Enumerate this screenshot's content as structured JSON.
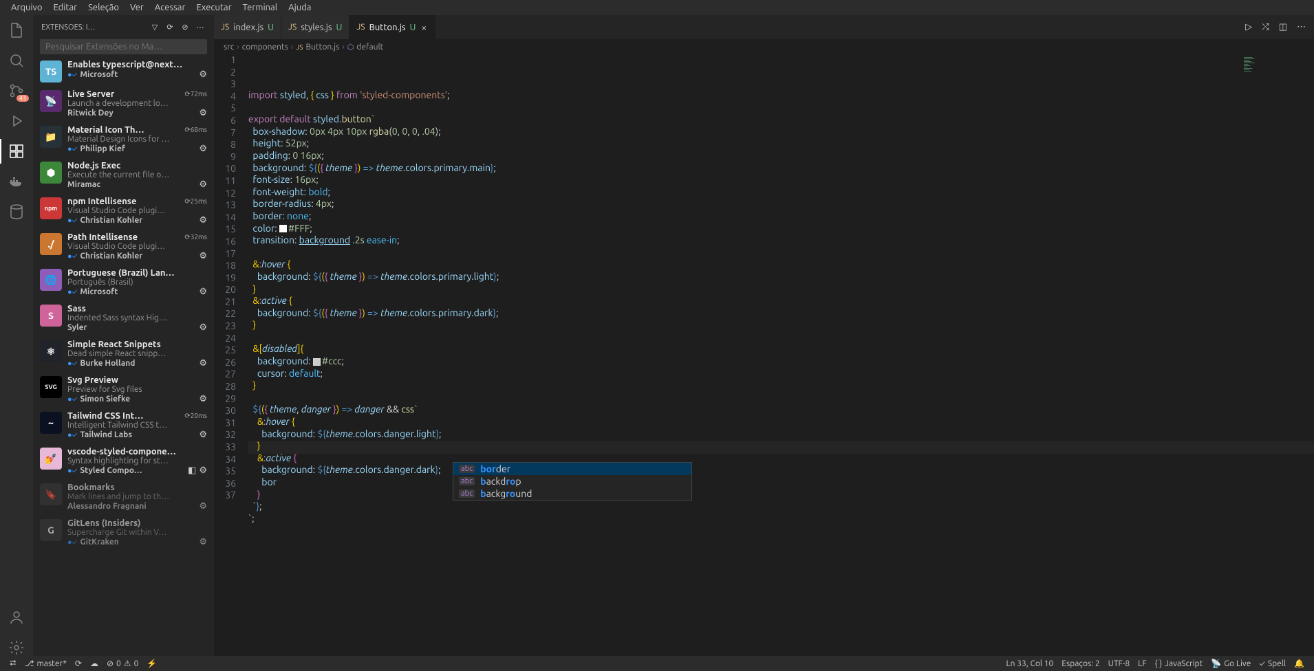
{
  "menubar": [
    "Arquivo",
    "Editar",
    "Seleção",
    "Ver",
    "Acessar",
    "Executar",
    "Terminal",
    "Ajuda"
  ],
  "sidebar": {
    "title": "EXTENSÕES: I…",
    "search_placeholder": "Pesquisar Extensões no Ma…",
    "items": [
      {
        "name": "Enables typescript@next…",
        "desc": "",
        "pub": "Microsoft",
        "verified": true,
        "time": "",
        "iconBg": "#5fb3d4",
        "iconTxt": "TS"
      },
      {
        "name": "Live Server",
        "desc": "Launch a development lo…",
        "pub": "Ritwick Dey",
        "verified": false,
        "time": "72ms",
        "iconBg": "#5a2a6e",
        "iconTxt": "📡"
      },
      {
        "name": "Material Icon Th…",
        "desc": "Material Design Icons for …",
        "pub": "Philipp Kief",
        "verified": true,
        "time": "68ms",
        "iconBg": "#263238",
        "iconTxt": "📁"
      },
      {
        "name": "Node.js Exec",
        "desc": "Execute the current file o…",
        "pub": "Miramac",
        "verified": false,
        "time": "",
        "iconBg": "#3c873a",
        "iconTxt": "⬢"
      },
      {
        "name": "npm Intellisense",
        "desc": "Visual Studio Code plugi…",
        "pub": "Christian Kohler",
        "verified": true,
        "time": "25ms",
        "iconBg": "#cb3837",
        "iconTxt": "npm"
      },
      {
        "name": "Path Intellisense",
        "desc": "Visual Studio Code plugi…",
        "pub": "Christian Kohler",
        "verified": true,
        "time": "32ms",
        "iconBg": "#cb7731",
        "iconTxt": "./"
      },
      {
        "name": "Portuguese (Brazil) Lan…",
        "desc": "Português (Brasil)",
        "pub": "Microsoft",
        "verified": true,
        "time": "",
        "iconBg": "#8f5db7",
        "iconTxt": "🌐"
      },
      {
        "name": "Sass",
        "desc": "Indented Sass syntax Hig…",
        "pub": "Syler",
        "verified": false,
        "time": "",
        "iconBg": "#cf649a",
        "iconTxt": "S"
      },
      {
        "name": "Simple React Snippets",
        "desc": "Dead simple React snipp…",
        "pub": "Burke Holland",
        "verified": true,
        "time": "",
        "iconBg": "#20232a",
        "iconTxt": "⚛"
      },
      {
        "name": "Svg Preview",
        "desc": "Preview for Svg files",
        "pub": "Simon Siefke",
        "verified": true,
        "time": "",
        "iconBg": "#000",
        "iconTxt": "SVG"
      },
      {
        "name": "Tailwind CSS Int…",
        "desc": "Intelligent Tailwind CSS t…",
        "pub": "Tailwind Labs",
        "verified": true,
        "time": "20ms",
        "iconBg": "#0b1120",
        "iconTxt": "~"
      },
      {
        "name": "vscode-styled-compone…",
        "desc": "Syntax highlighting for st…",
        "pub": "Styled Compo…",
        "verified": true,
        "time": "",
        "iconBg": "#e7b8d8",
        "iconTxt": "💅",
        "extra": "◧"
      },
      {
        "name": "Bookmarks",
        "desc": "Mark lines and jump to th…",
        "pub": "Alessandro Fragnani",
        "verified": false,
        "time": "",
        "iconBg": "#3a3a3a",
        "iconTxt": "🔖",
        "dim": true
      },
      {
        "name": "GitLens (Insiders)",
        "desc": "Supercharge Git within V…",
        "pub": "GitKraken",
        "verified": true,
        "time": "",
        "iconBg": "#3a3a3a",
        "iconTxt": "G",
        "dim": true
      }
    ]
  },
  "tabs": [
    {
      "label": "index.js",
      "status": "U",
      "active": false
    },
    {
      "label": "styles.js",
      "status": "U",
      "active": false
    },
    {
      "label": "Button.js",
      "status": "U",
      "active": true
    }
  ],
  "breadcrumb": [
    "src",
    "components",
    "Button.js",
    "default"
  ],
  "code": {
    "lines": 37,
    "text": "import styled, { css } from 'styled-components';\n\nexport default styled.button`\n  box-shadow: 0px 4px 10px rgba(0, 0, 0, .04);\n  height: 52px;\n  padding: 0 16px;\n  background: ${({ theme }) => theme.colors.primary.main};\n  font-size: 16px;\n  font-weight: bold;\n  border-radius: 4px;\n  border: none;\n  color: #FFF;\n  transition: background .2s ease-in;\n\n  &:hover {\n    background: ${({ theme }) => theme.colors.primary.light};\n  }\n  &:active {\n    background: ${({ theme }) => theme.colors.primary.dark};\n  }\n\n  &[disabled]{\n    background: #ccc;\n    cursor: default;\n  }\n\n  ${({ theme, danger }) => danger && css`\n    &:hover {\n      background: ${theme.colors.danger.light};\n    }\n    &:active {\n      background: ${theme.colors.danger.dark};\n      bor\n    }\n  `};\n`;\n"
  },
  "suggest": {
    "items": [
      {
        "label": "border",
        "match": "bor"
      },
      {
        "label": "backdrop",
        "match": "b"
      },
      {
        "label": "background",
        "match": "b"
      }
    ]
  },
  "status": {
    "branch": "master*",
    "sync": "⟳",
    "errors": "0",
    "warnings": "0",
    "port": "⚡",
    "position": "Ln 33, Col 10",
    "spaces": "Espaços: 2",
    "encoding": "UTF-8",
    "eol": "LF",
    "lang": "JavaScript",
    "golive": "Go Live",
    "spell": "Spell"
  }
}
